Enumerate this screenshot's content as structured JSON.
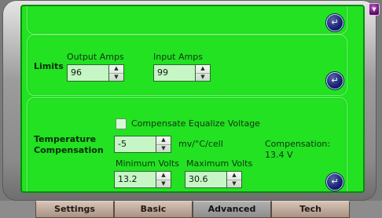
{
  "limits": {
    "title": "Limits",
    "output_amps_label": "Output Amps",
    "output_amps_value": "96",
    "input_amps_label": "Input Amps",
    "input_amps_value": "99"
  },
  "temperature": {
    "title_line1": "Temperature",
    "title_line2": "Compensation",
    "checkbox_label": "Compensate Equalize Voltage",
    "comp_value": "-5",
    "comp_unit": "mv/°C/cell",
    "compensation_label": "Compensation:",
    "compensation_value": "13.4 V",
    "min_volts_label": "Minimum Volts",
    "min_volts_value": "13.2",
    "max_volts_label": "Maximum Volts",
    "max_volts_value": "30.6"
  },
  "icons": {
    "enter": "↵",
    "arrow_up": "▲",
    "arrow_down": "▼",
    "scroll_up": "▲",
    "scroll_down": "▼",
    "corner": "▼"
  },
  "tabs": [
    {
      "label": "Settings"
    },
    {
      "label": "Basic"
    },
    {
      "label": "Advanced",
      "active": true
    },
    {
      "label": "Tech"
    }
  ],
  "colors": {
    "panel_green": "#22e222",
    "field_green": "#c6f5c6",
    "enter_button": "#0c1a6a"
  }
}
